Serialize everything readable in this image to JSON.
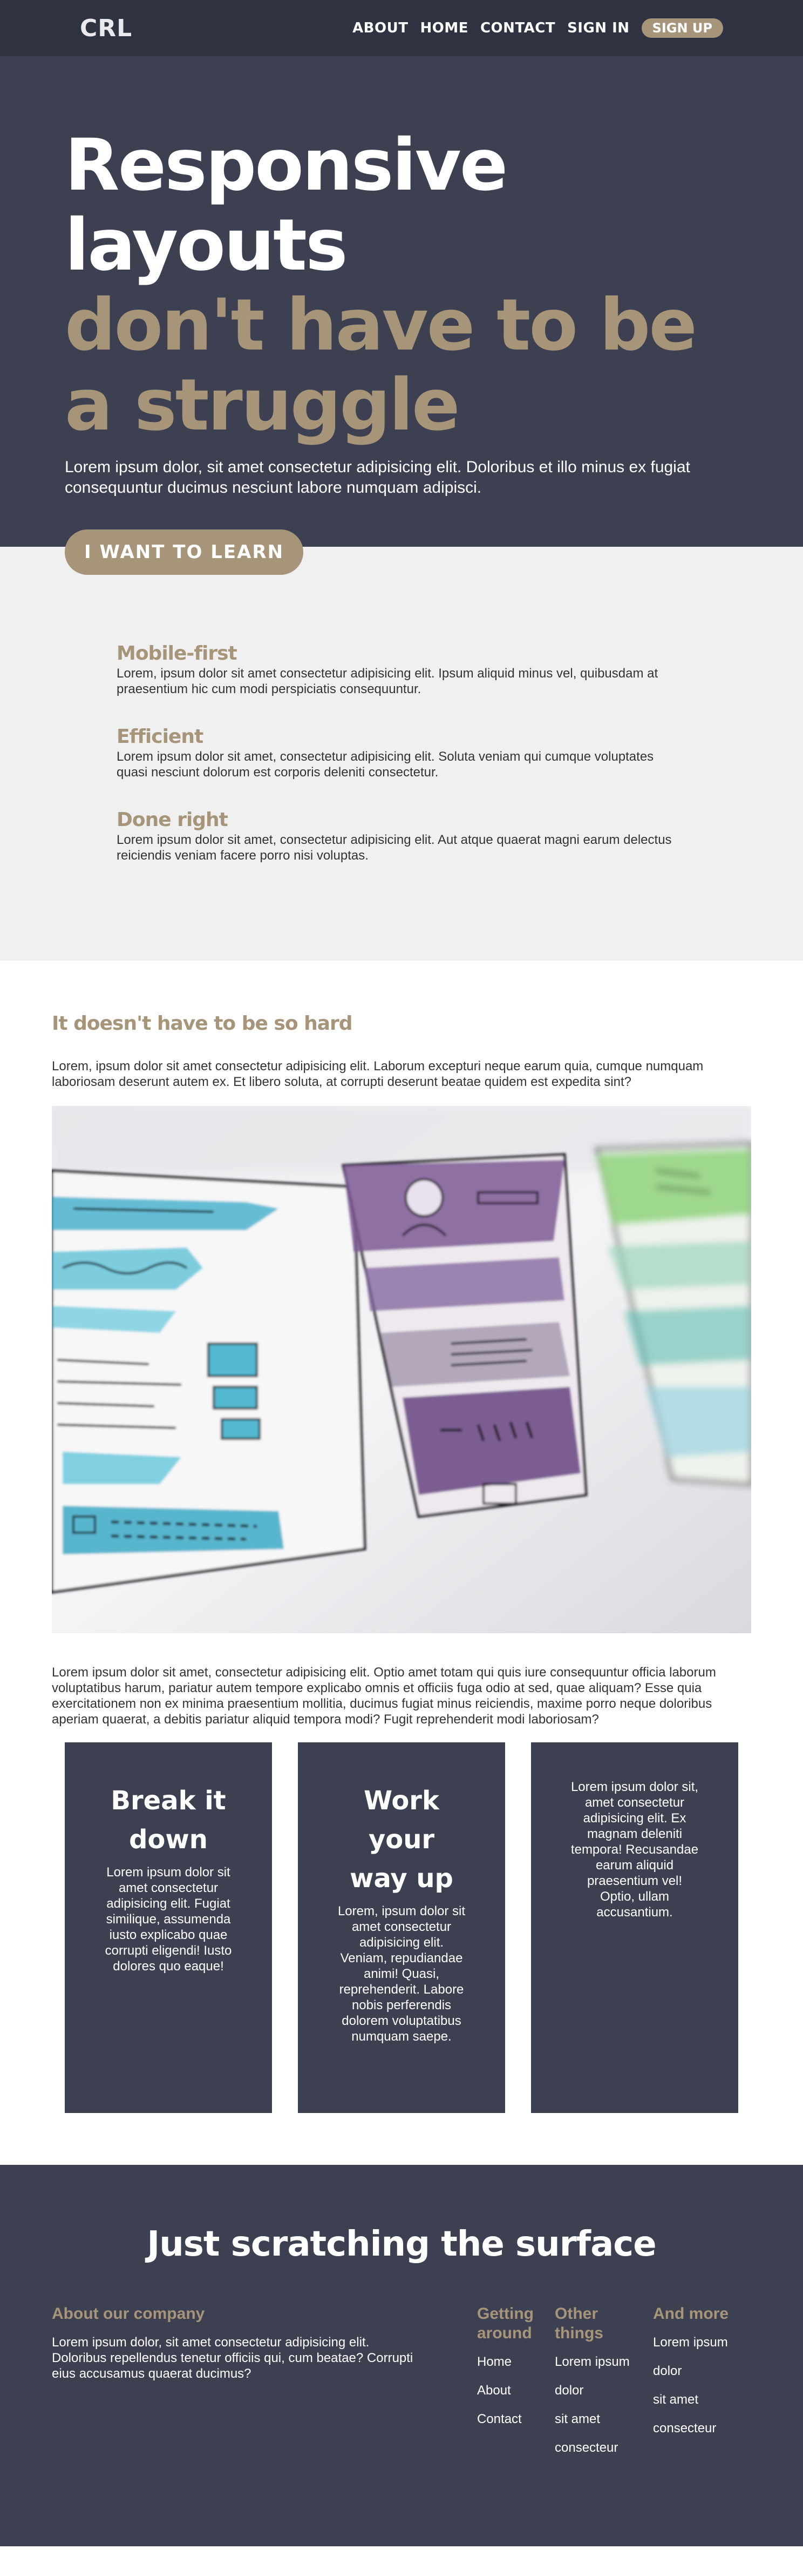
{
  "nav": {
    "logo": "CRL",
    "links": [
      "ABOUT",
      "HOME",
      "CONTACT",
      "SIGN IN"
    ],
    "cta": "SIGN UP"
  },
  "hero": {
    "title_line1": "Responsive layouts",
    "title_line2": "don't have to be a struggle",
    "subtitle": "Lorem ipsum dolor, sit amet consectetur adipisicing elit. Doloribus et illo minus ex fugiat consequuntur ducimus nesciunt labore numquam adipisci.",
    "button": "I WANT TO LEARN"
  },
  "features": [
    {
      "title": "Mobile-first",
      "text": "Lorem, ipsum dolor sit amet consectetur adipisicing elit. Ipsum aliquid minus vel, quibusdam at praesentium hic cum modi perspiciatis consequuntur."
    },
    {
      "title": "Efficient",
      "text": "Lorem ipsum dolor sit amet, consectetur adipisicing elit. Soluta veniam qui cumque voluptates quasi nesciunt dolorum est corporis deleniti consectetur."
    },
    {
      "title": "Done right",
      "text": "Lorem ipsum dolor sit amet, consectetur adipisicing elit. Aut atque quaerat magni earum delectus reiciendis veniam facere porro nisi voluptas."
    }
  ],
  "article": {
    "title": "It doesn't have to be so hard",
    "p1": "Lorem, ipsum dolor sit amet consectetur adipisicing elit. Laborum excepturi neque earum quia, cumque numquam laboriosam deserunt autem ex. Et libero soluta, at corrupti deserunt beatae quidem est expedita sint?",
    "p2": "Lorem ipsum dolor sit amet, consectetur adipisicing elit. Optio amet totam qui quis iure consequuntur officia laborum voluptatibus harum, pariatur autem tempore explicabo omnis et officiis fuga odio at sed, quae aliquam? Esse quia exercitationem non ex minima praesentium mollitia, ducimus fugiat minus reiciendis, maxime porro neque doloribus aperiam quaerat, a debitis pariatur aliquid tempora modi? Fugit reprehenderit modi laboriosam?"
  },
  "cards": [
    {
      "title": "Break it down",
      "text": "Lorem ipsum dolor sit amet consectetur adipisicing elit. Fugiat similique, assumenda iusto explicabo quae corrupti eligendi! Iusto dolores quo eaque!"
    },
    {
      "title": "Work your way up",
      "text": "Lorem, ipsum dolor sit amet consectetur adipisicing elit. Veniam, repudiandae animi! Quasi, reprehenderit. Labore nobis perferendis dolorem voluptatibus numquam saepe."
    },
    {
      "title": "",
      "text": "Lorem ipsum dolor sit, amet consectetur adipisicing elit. Ex magnam deleniti tempora! Recusandae earum aliquid praesentium vel! Optio, ullam accusantium."
    }
  ],
  "footer": {
    "title": "Just scratching the surface",
    "about_heading": "About our company",
    "about_text": "Lorem ipsum dolor, sit amet consectetur adipisicing elit. Doloribus repellendus tenetur officiis qui, cum beatae? Corrupti eius accusamus quaerat ducimus?",
    "col1_heading": "Getting around",
    "col1_items": [
      "Home",
      "About",
      "Contact"
    ],
    "col2_heading": "Other things",
    "col2_items": [
      "Lorem ipsum",
      "dolor",
      "sit amet",
      "consecteur"
    ],
    "col3_heading": "And more",
    "col3_items": [
      "Lorem ipsum",
      "dolor",
      "sit amet",
      "consecteur"
    ]
  },
  "colors": {
    "dark": "#3d4051",
    "nav_dark": "#2f3241",
    "accent": "#a7957a",
    "light_bg": "#f0f0f0"
  },
  "icons": {
    "hero_image": "watercolor-wireframe-sketches-image"
  }
}
